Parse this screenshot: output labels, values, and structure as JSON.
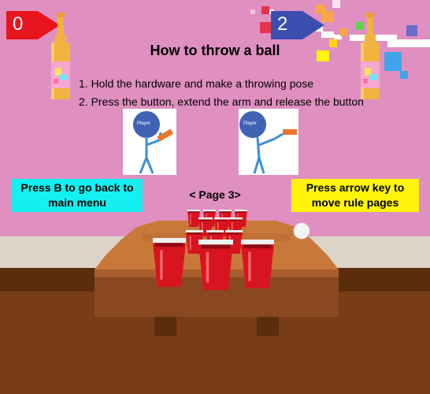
{
  "colors": {
    "background_pink": "#e08fc1",
    "wall": "#ddd4c9",
    "floor_top": "#5a2d0c",
    "floor": "#7a3c16",
    "table_top": "#c8793a",
    "table_side": "#8a4820",
    "cup_red": "#d81420",
    "left_team_flag": "#e8141e",
    "right_team_flag": "#3a4fb0",
    "back_button_bg": "#14f0f0",
    "rules_button_bg": "#fff40a"
  },
  "scoreboard": {
    "left_score": "0",
    "right_score": "2"
  },
  "rules": {
    "title": "How to throw a ball",
    "steps": [
      "1. Hold the hardware and make a throwing pose",
      "2. Press the button, extend the arm and release the button"
    ],
    "figure_labels": [
      "Player",
      "Player"
    ]
  },
  "navigation": {
    "back_hint": "Press B to go back to main menu",
    "page_label": "< Page 3>",
    "rules_hint": "Press arrow key to move rule pages"
  },
  "icons": [
    "beer-bottle-icon",
    "beer-bottle-icon",
    "ping-pong-ball-icon",
    "red-cup-icon"
  ]
}
